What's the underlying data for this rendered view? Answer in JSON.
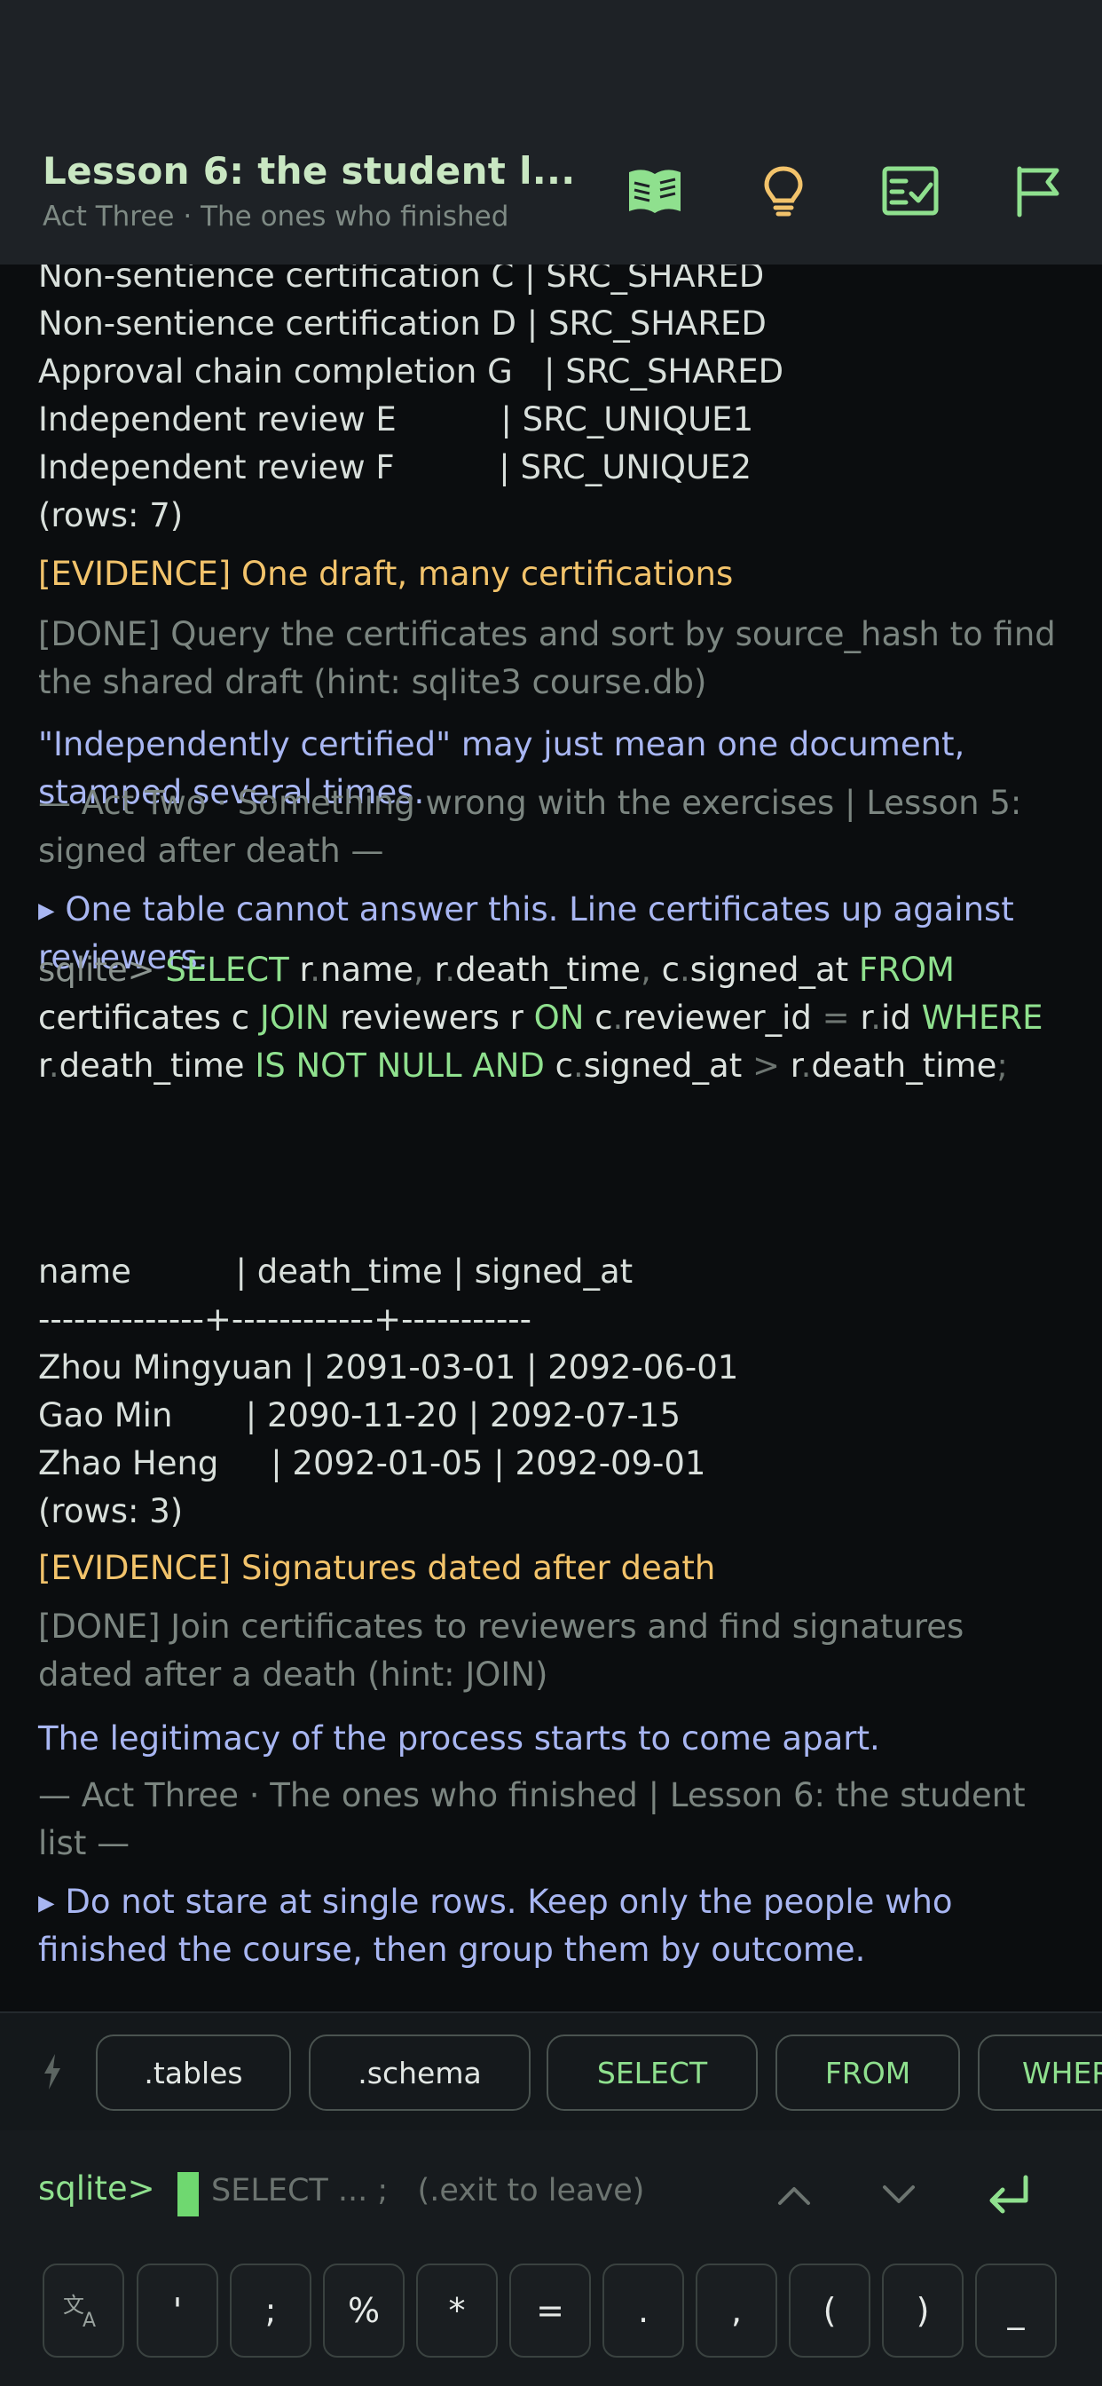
{
  "header": {
    "title": "Lesson 6: the student l...",
    "subtitle": "Act Three · The ones who finished",
    "icons": [
      "book-icon",
      "lightbulb-icon",
      "checklist-icon",
      "flag-icon"
    ]
  },
  "terminal": {
    "rows_top": [
      "Non-sentience certification C | SRC_SHARED",
      "Non-sentience certification D | SRC_SHARED",
      "Approval chain completion G   | SRC_SHARED",
      "Independent review E          | SRC_UNIQUE1",
      "Independent review F          | SRC_UNIQUE2",
      "(rows: 7)"
    ],
    "evidence1": "[EVIDENCE] One draft, many certifications",
    "done1": "[DONE] Query the certificates and sort by source_hash to find the shared draft (hint: sqlite3 course.db)",
    "note1": "\"Independently certified\" may just mean one document, stamped several times.",
    "act1": "— Act Two · Something wrong with the exercises | Lesson 5: signed after death —",
    "hint1": "▸ One table cannot answer this. Line certificates up against reviewers.",
    "query": {
      "prompt": "sqlite>",
      "tokens": {
        "select": "SELECT",
        "r1": "r",
        "name": "name",
        "c1": "c",
        "signed1": "signed_at",
        "from": "FROM",
        "certs": "certificates c",
        "join": "JOIN",
        "reviewers": "reviewers r",
        "on": "ON",
        "c2": "c",
        "reviewer_id": "reviewer_id",
        "r2": "r",
        "id": "id",
        "where": "WHERE",
        "r3": "r",
        "death1": "death_time",
        "isnotnull": "IS NOT NULL",
        "and": "AND",
        "c3": "c",
        "signed2": "signed_at",
        "r4": "r",
        "death2": "death_time",
        "r_dt": "r",
        "death_time_sel": "death_time"
      }
    },
    "result_header": "name          | death_time | signed_at",
    "result_divider": "--------------+------------+-----------",
    "result_rows": [
      "Zhou Mingyuan | 2091-03-01 | 2092-06-01",
      "Gao Min       | 2090-11-20 | 2092-07-15",
      "Zhao Heng     | 2092-01-05 | 2092-09-01"
    ],
    "rows_count": "(rows: 3)",
    "evidence2": "[EVIDENCE] Signatures dated after death",
    "done2": "[DONE] Join certificates to reviewers and find signatures dated after a death (hint: JOIN)",
    "note2": "The legitimacy of the process starts to come apart.",
    "act2": "— Act Three · The ones who finished | Lesson 6: the student list —",
    "hint2": "▸ Do not stare at single rows. Keep only the people who finished the course, then group them by outcome."
  },
  "chips": [
    ".tables",
    ".schema",
    "SELECT",
    "FROM",
    "WHERE"
  ],
  "input": {
    "prompt": "sqlite>",
    "placeholder": "SELECT ... ;   (.exit to leave)"
  },
  "keys": [
    "'",
    ";",
    "%",
    "*",
    "=",
    ".",
    ",",
    "(",
    ")",
    "_"
  ],
  "colors": {
    "accent": "#8fe08e",
    "evidence": "#f2c36b",
    "note": "#a8b6f2",
    "muted": "#7b8580",
    "background": "#0b0d0f"
  }
}
